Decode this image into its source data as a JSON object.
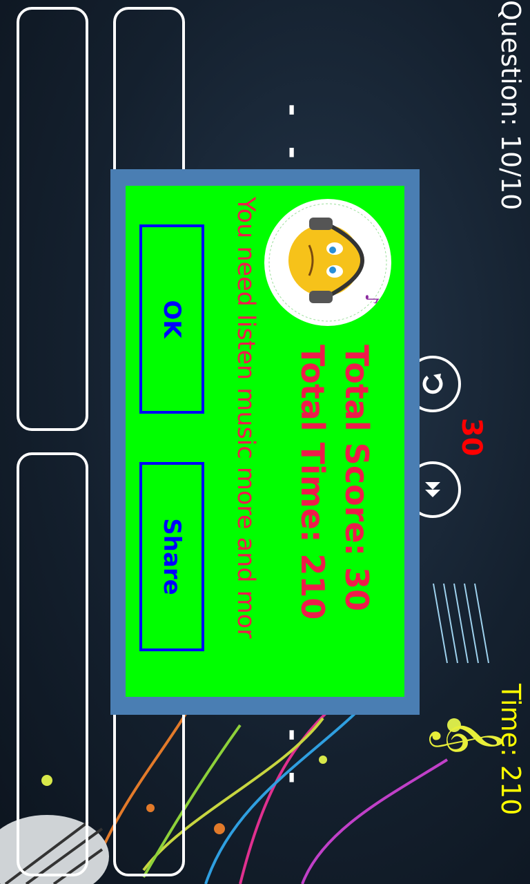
{
  "hud": {
    "question": "Question: 10/10",
    "score": "30",
    "time": "Time: 210",
    "dashes_top": "- -",
    "dashes_bottom": "- -"
  },
  "controls": {
    "replay_icon": "replay-icon",
    "skip_icon": "fast-forward-icon"
  },
  "dialog": {
    "total_score": "Total Score: 30",
    "total_time": "Total Time: 210",
    "message": "You need listen music more and mor",
    "ok_label": "OK",
    "share_label": "Share",
    "mascot_icon": "smiley-headphones-icon"
  },
  "colors": {
    "dialog_frame": "#4a7eb3",
    "dialog_bg": "#00ff00",
    "dialog_text": "#ee1c4a",
    "button_border": "#0000ff",
    "score_hud": "#ff0000",
    "time_hud": "#ffff00"
  }
}
